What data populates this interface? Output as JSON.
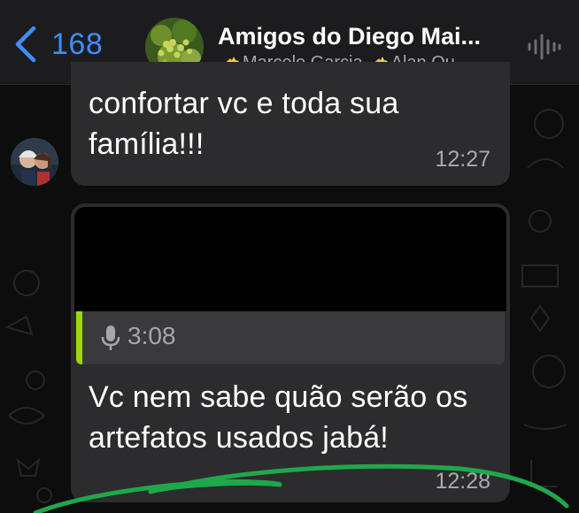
{
  "header": {
    "back_count": "168",
    "group_name": "Amigos do Diego Mai...",
    "members": [
      "Marcelo Garcia",
      "Alan Qu..."
    ]
  },
  "messages": [
    {
      "lines": [
        "confortar vc e toda sua",
        "família!!!"
      ],
      "time": "12:27"
    },
    {
      "reply_duration": "3:08",
      "lines": [
        "Vc nem sabe quão serão os",
        "artefatos usados jabá!"
      ],
      "time": "12:28"
    }
  ],
  "colors": {
    "accent": "#3f8cff",
    "bubble": "#2c2c2e",
    "reply_bar": "#9ed60c",
    "annotation": "#1fa84a"
  },
  "icons": {
    "back": "chevron-left-icon",
    "member_badge": "sparkle-emoji-icon",
    "call": "voice-wave-icon",
    "reply_type": "microphone-icon"
  }
}
